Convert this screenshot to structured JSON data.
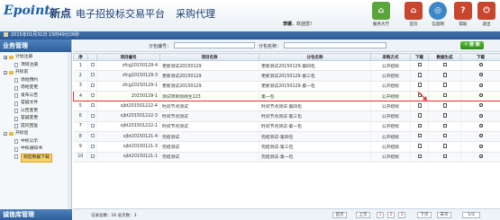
{
  "header": {
    "logo": "Epoint",
    "logo_cn": "新点",
    "platform_title": "电子招投标交易平台",
    "module_title": "采购代理",
    "user_name": "李娜",
    "greeting": "，欢迎您！",
    "buttons": [
      {
        "label": "服务大厅",
        "icon": "service-hall-icon",
        "color": "#5aa63a"
      },
      {
        "label": "首页",
        "icon": "home-icon",
        "color": "#c8452e"
      },
      {
        "label": "信息网",
        "icon": "globe-icon",
        "color": "#3d86c7"
      },
      {
        "label": "帮助",
        "icon": "help-icon",
        "color": "#c8452e"
      },
      {
        "label": "退出",
        "icon": "power-icon",
        "color": "#c8452e"
      }
    ]
  },
  "datebar": {
    "text": "2015年01月31日 15时49分26秒"
  },
  "sidebar": {
    "title": "业务管理",
    "footer": "诚信库管理",
    "tree": [
      {
        "label": "计划注册",
        "level": 0,
        "toggle": "+",
        "type": "folder"
      },
      {
        "label": "项目注册",
        "level": 1,
        "type": "leaf"
      },
      {
        "label": "开标前",
        "level": 0,
        "toggle": "-",
        "type": "folder"
      },
      {
        "label": "场地预约",
        "level": 1,
        "type": "leaf"
      },
      {
        "label": "场地变更",
        "level": 1,
        "type": "leaf"
      },
      {
        "label": "发布公告",
        "level": 1,
        "type": "leaf"
      },
      {
        "label": "答疑文件",
        "level": 1,
        "type": "leaf"
      },
      {
        "label": "公告变更",
        "level": 1,
        "type": "leaf"
      },
      {
        "label": "答疑变更",
        "level": 1,
        "type": "leaf"
      },
      {
        "label": "提问回复",
        "level": 1,
        "type": "leaf"
      },
      {
        "label": "开标后",
        "level": 0,
        "toggle": "-",
        "type": "folder"
      },
      {
        "label": "中标公示",
        "level": 1,
        "type": "leaf"
      },
      {
        "label": "中标通知书",
        "level": 1,
        "type": "leaf"
      },
      {
        "label": "标后数据下载",
        "level": 1,
        "type": "leaf",
        "selected": true
      }
    ]
  },
  "search": {
    "package_no_label": "分包编号：",
    "package_no_value": "",
    "package_name_label": "分包名称：",
    "package_name_value": "",
    "button": "搜 索"
  },
  "table": {
    "columns": [
      "序",
      "",
      "项目编号",
      "项目名称",
      "分包名称",
      "采购方式",
      "下载",
      "数据生成",
      "下载"
    ],
    "rows": [
      {
        "no": "1",
        "code": "zfcg20150129-4",
        "project": "更新测试20150129",
        "package": "更新测试20150129-第四包",
        "method": "公开招标"
      },
      {
        "no": "2",
        "code": "zfcg20150129-3",
        "project": "更新测试20150129",
        "package": "更新测试20150129-第三包",
        "method": "公开招标"
      },
      {
        "no": "3",
        "code": "zfcg20150129-1",
        "project": "更新测试20150129",
        "package": "更新测试20150129-第一包",
        "method": "公开招标"
      },
      {
        "no": "4",
        "code": "20150129-1",
        "project": "测试项目划线生123",
        "package": "第一包",
        "method": "公开招标",
        "highlight": true
      },
      {
        "no": "5",
        "code": "xjbt201501222-4",
        "project": "时间节点测试",
        "package": "时间节点测试-第四包",
        "method": "公开招标"
      },
      {
        "no": "6",
        "code": "xjbt201501222-3",
        "project": "时间节点测试",
        "package": "时间节点测试-第三包",
        "method": "公开招标"
      },
      {
        "no": "7",
        "code": "xjbt201501222-1",
        "project": "时间节点测试",
        "package": "时间节点测试-第一包",
        "method": "公开招标"
      },
      {
        "no": "8",
        "code": "xjbt20150121-4",
        "project": "完结测试",
        "package": "完结测试-第四包",
        "method": "公开招标"
      },
      {
        "no": "9",
        "code": "xjbt20150121-3",
        "project": "完结测试",
        "package": "完结测试-第三包",
        "method": "公开招标"
      },
      {
        "no": "10",
        "code": "xjbt20150121-1",
        "project": "完结测试",
        "package": "完结测试-第一包",
        "method": "公开招标"
      }
    ]
  },
  "pager": {
    "info": "记录总数：26    总页数：3",
    "first": "首页",
    "prev": "上页",
    "pages": [
      "1",
      "2",
      "3"
    ],
    "next": "下页",
    "last": "末页",
    "current": "1/3"
  }
}
